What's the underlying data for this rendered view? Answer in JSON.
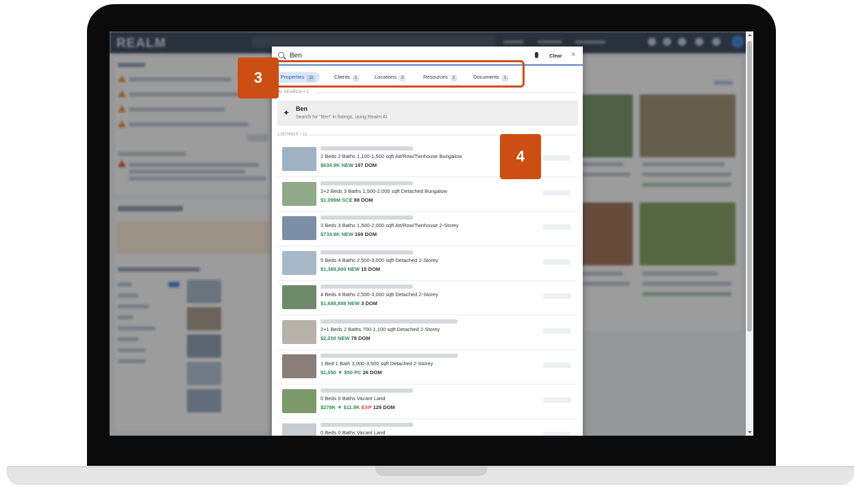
{
  "background_app": {
    "logo": "REALM"
  },
  "search": {
    "query": "Ben",
    "clear_label": "Clear",
    "close_label": "×"
  },
  "tabs": [
    {
      "label": "Properties",
      "count": "11"
    },
    {
      "label": "Clients",
      "count": "1"
    },
    {
      "label": "Locations",
      "count": "2"
    },
    {
      "label": "Resources",
      "count": "2"
    },
    {
      "label": "Documents",
      "count": "1"
    }
  ],
  "ai_search": {
    "section_label": "AI SEARCH • 1",
    "title": "Ben",
    "subtitle": "Search for \"Ben\" in listings, using Realm AI"
  },
  "listings_section_label": "LISTINGS • 11",
  "listings": [
    {
      "specs": "2 Beds  2 Baths  1,100-1,500 sqft  Att/Row/Twnhouse  Bungalow",
      "price": "$634.9K",
      "change": "",
      "status": "NEW",
      "dom": "197 DOM",
      "thumb_color": "#9fb2c4"
    },
    {
      "specs": "2+2 Beds  3 Baths  1,500-2,000 sqft  Detached  Bungalow",
      "price": "$1.099M",
      "change": "",
      "status": "SCE",
      "dom": "88 DOM",
      "thumb_color": "#8fa98a"
    },
    {
      "specs": "3 Beds  3 Baths  1,500-2,000 sqft  Att/Row/Twnhouse  2-Storey",
      "price": "$734.9K",
      "change": "",
      "status": "NEW",
      "dom": "169 DOM",
      "thumb_color": "#7d8fa6"
    },
    {
      "specs": "5 Beds  4 Baths  2,500-3,000 sqft  Detached  2-Storey",
      "price": "$1,389,800",
      "change": "",
      "status": "NEW",
      "dom": "15 DOM",
      "thumb_color": "#a7b8c9"
    },
    {
      "specs": "4 Beds  4 Baths  2,500-3,000 sqft  Detached  2-Storey",
      "price": "$1,688,888",
      "change": "",
      "status": "NEW",
      "dom": "3 DOM",
      "thumb_color": "#6f8a6b"
    },
    {
      "specs": "2+1 Beds  2 Baths  700-1,100 sqft  Detached  2-Storey",
      "price": "$2,200",
      "change": "",
      "status": "NEW",
      "dom": "78 DOM",
      "thumb_color": "#b8b3aa"
    },
    {
      "specs": "1 Bed  1 Bath  3,000-3,500 sqft  Detached  2-Storey",
      "price": "$1,050",
      "change": "▼ $50",
      "status": "PC",
      "dom": "26 DOM",
      "thumb_color": "#8a7f78"
    },
    {
      "specs": "0 Beds  0 Baths  Vacant Land",
      "price": "$278K",
      "change": "▼ $11.9K",
      "status": "EXP",
      "dom": "129 DOM",
      "thumb_color": "#7d9a6a"
    },
    {
      "specs": "0 Beds  0 Baths  Vacant Land",
      "price": "",
      "change": "",
      "status": "",
      "dom": "",
      "thumb_color": "#c7ccd1"
    }
  ],
  "annotations": [
    {
      "label": "3"
    },
    {
      "label": "4"
    }
  ],
  "colors": {
    "accent": "#2d5ea8",
    "annotation": "#cc4e12",
    "price_green": "#2e8b57",
    "exp_red": "#d9442b"
  }
}
